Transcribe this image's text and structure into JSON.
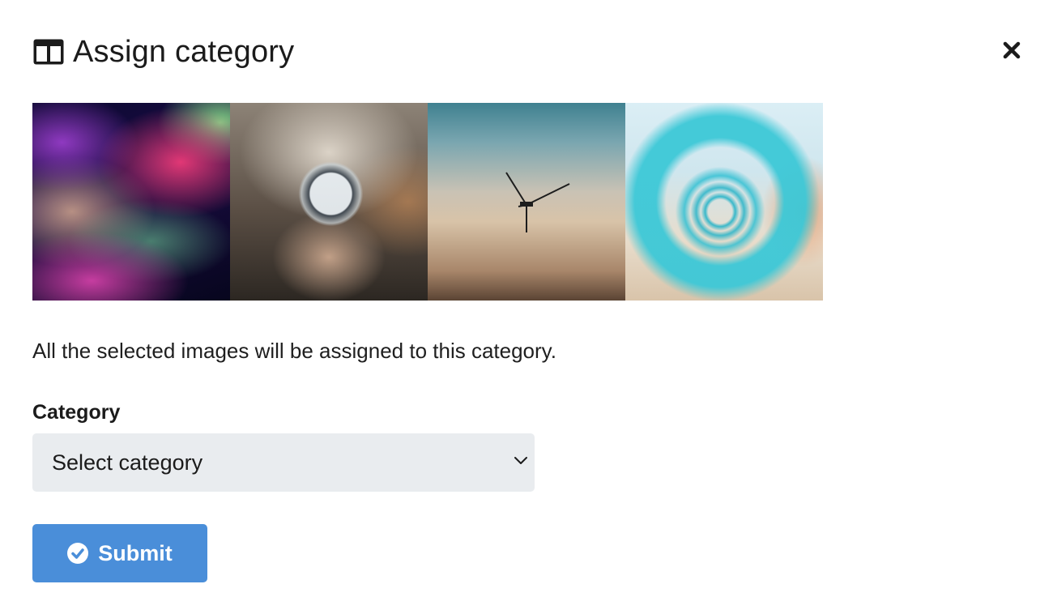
{
  "modal": {
    "title": "Assign category",
    "title_icon": "columns-icon",
    "close_icon": "close-icon"
  },
  "images": [
    {
      "name": "abstract-waves-image"
    },
    {
      "name": "crystal-ball-image"
    },
    {
      "name": "wind-turbine-image"
    },
    {
      "name": "spiral-lens-image"
    }
  ],
  "description": "All the selected images will be assigned to this category.",
  "form": {
    "category_label": "Category",
    "select_value": "Select category",
    "select_icon": "chevron-down-icon"
  },
  "submit": {
    "label": "Submit",
    "icon": "check-circle-icon",
    "bg_color": "#4a8ed9"
  }
}
